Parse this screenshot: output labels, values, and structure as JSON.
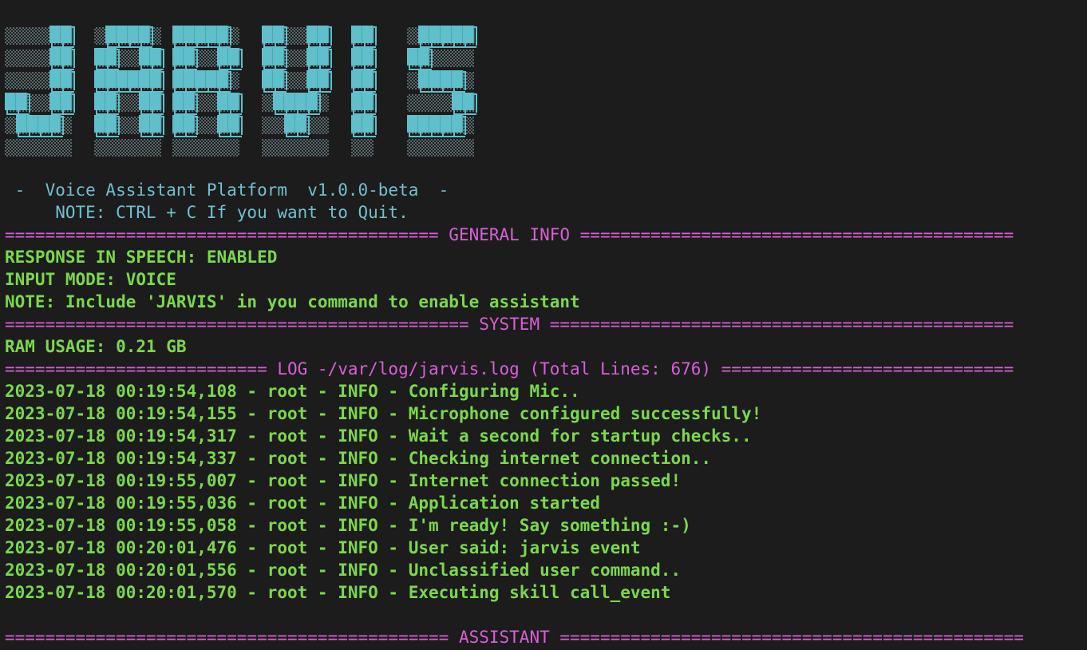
{
  "colors": {
    "background": "#1c1c1c",
    "banner": "#5fbfcb",
    "header": "#6fc1cf",
    "divider": "#d95fd9",
    "text": "#7bd84a"
  },
  "banner": {
    "logo_text": "JARVIS"
  },
  "header": {
    "subtitle": " -  Voice Assistant Platform  v1.0.0-beta  -",
    "note": "     NOTE: CTRL + C If you want to Quit."
  },
  "general_info": {
    "divider": "=========================================== GENERAL INFO ===========================================",
    "lines": [
      "RESPONSE IN SPEECH: ENABLED",
      "INPUT MODE: VOICE",
      "NOTE: Include 'JARVIS' in you command to enable assistant"
    ]
  },
  "system": {
    "divider": "============================================== SYSTEM ==============================================",
    "lines": [
      "RAM USAGE: 0.21 GB"
    ]
  },
  "log": {
    "divider": "========================== LOG -/var/log/jarvis.log (Total Lines: 676) =============================",
    "lines": [
      "2023-07-18 00:19:54,108 - root - INFO - Configuring Mic..",
      "2023-07-18 00:19:54,155 - root - INFO - Microphone configured successfully!",
      "2023-07-18 00:19:54,317 - root - INFO - Wait a second for startup checks..",
      "2023-07-18 00:19:54,337 - root - INFO - Checking internet connection..",
      "2023-07-18 00:19:55,007 - root - INFO - Internet connection passed!",
      "2023-07-18 00:19:55,036 - root - INFO - Application started",
      "2023-07-18 00:19:55,058 - root - INFO - I'm ready! Say something :-)",
      "2023-07-18 00:20:01,476 - root - INFO - User said: jarvis event",
      "2023-07-18 00:20:01,556 - root - INFO - Unclassified user command..",
      "2023-07-18 00:20:01,570 - root - INFO - Executing skill call_event"
    ]
  },
  "assistant": {
    "divider": "============================================ ASSISTANT =============================================="
  }
}
